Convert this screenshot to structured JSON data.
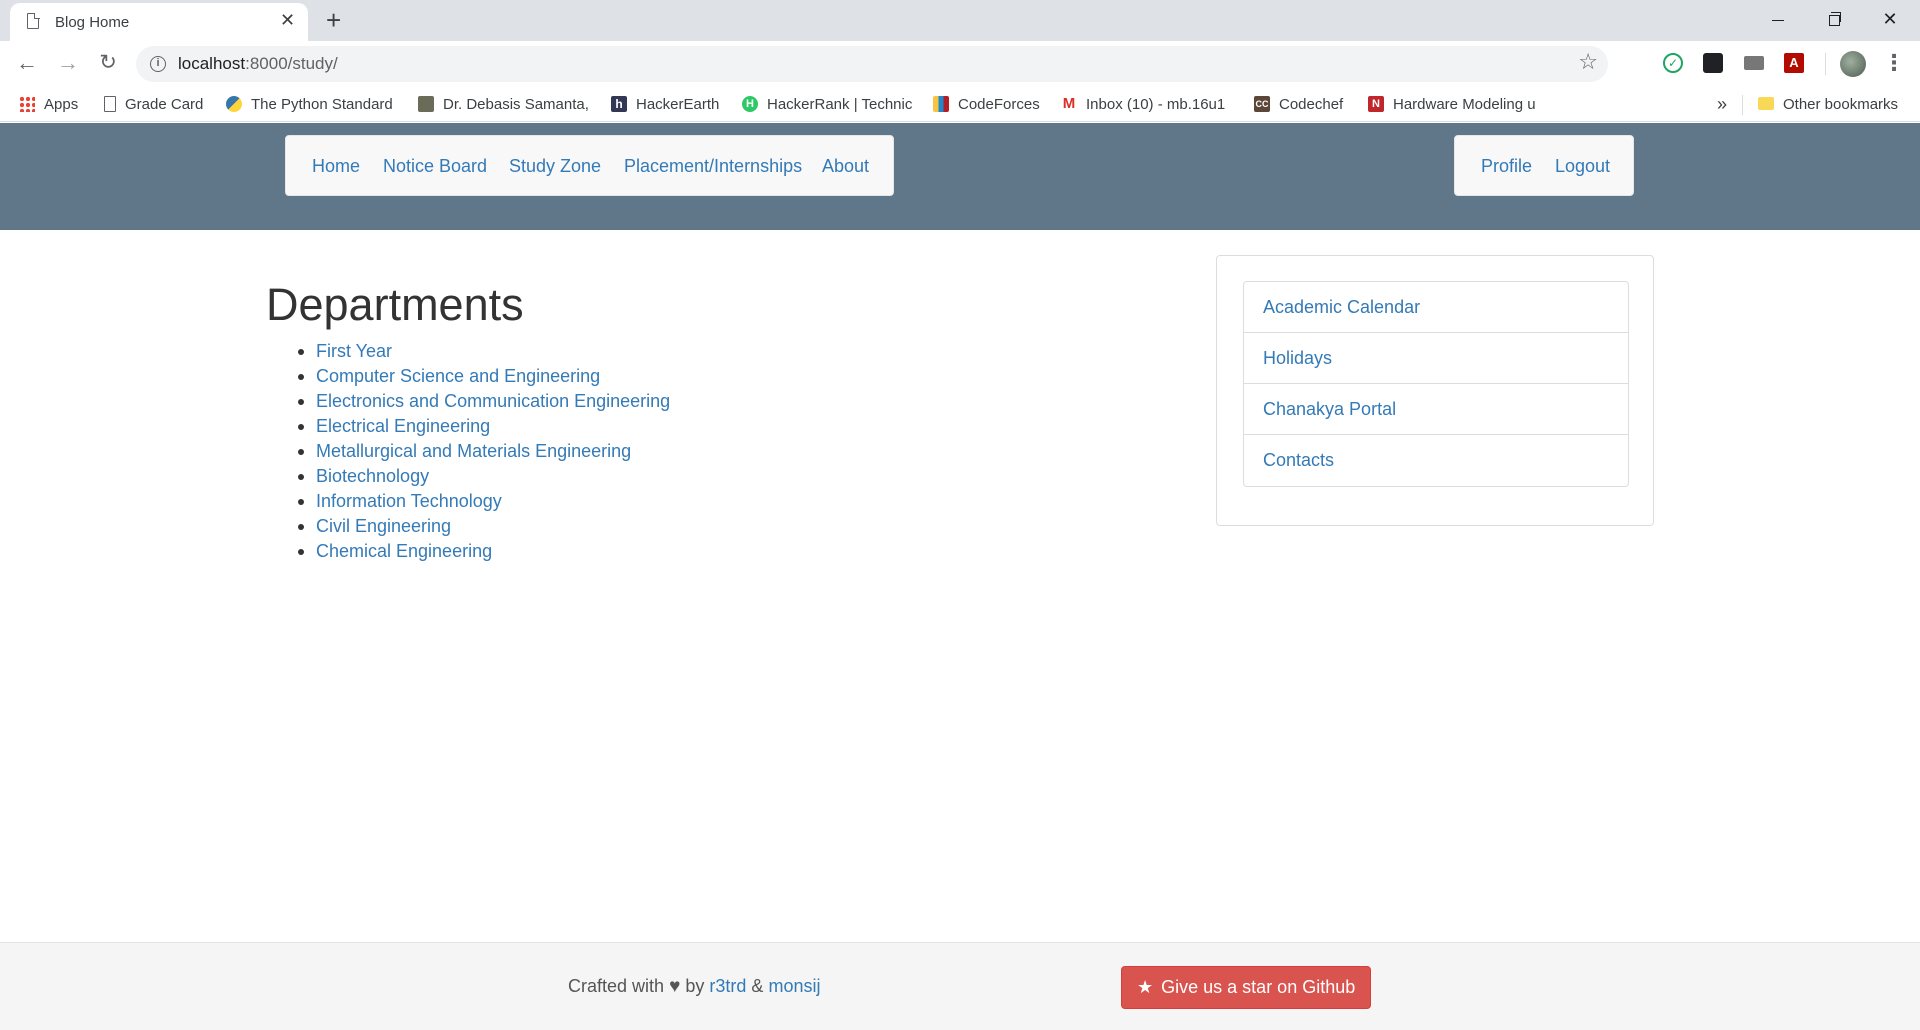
{
  "browser": {
    "tab_title": "Blog Home",
    "new_tab": "+",
    "url_host": "localhost",
    "url_path": ":8000/study/",
    "bookmarks": [
      "Apps",
      "Grade Card",
      "The Python Standard",
      "Dr. Debasis Samanta,",
      "HackerEarth",
      "HackerRank | Technic",
      "CodeForces",
      "Inbox (10) - mb.16u1",
      "Codechef",
      "Hardware Modeling u"
    ],
    "bookmarks_more": "»",
    "other_bookmarks": "Other bookmarks"
  },
  "nav": {
    "left": [
      "Home",
      "Notice Board",
      "Study Zone",
      "Placement/Internships",
      "About"
    ],
    "right": [
      "Profile",
      "Logout"
    ]
  },
  "main": {
    "heading": "Departments",
    "departments": [
      "First Year",
      "Computer Science and Engineering",
      "Electronics and Communication Engineering",
      "Electrical Engineering",
      "Metallurgical and Materials Engineering",
      "Biotechnology",
      "Information Technology",
      "Civil Engineering",
      "Chemical Engineering"
    ]
  },
  "sidebar": {
    "links": [
      "Academic Calendar",
      "Holidays",
      "Chanakya Portal",
      "Contacts"
    ]
  },
  "footer": {
    "crafted_with": "Crafted with",
    "by": "by",
    "author1": "r3trd",
    "amp": "&",
    "author2": "monsij",
    "github_button": "Give us a star on Github"
  },
  "colors": {
    "hero": "#607789",
    "link": "#337ab7",
    "github_button": "#d9534f"
  }
}
